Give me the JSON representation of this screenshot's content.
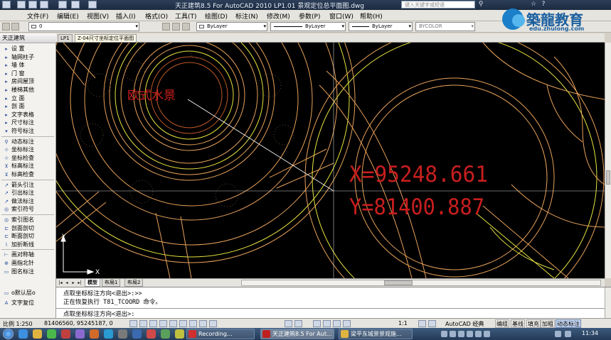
{
  "window": {
    "title": "天正建筑8.5 For AutoCAD 2010    LP1.01 景观定位总平面图.dwg",
    "search_placeholder": "键入关键字或短语"
  },
  "menu": {
    "items": [
      "文件(F)",
      "编辑(E)",
      "视图(V)",
      "插入(I)",
      "格式(O)",
      "工具(T)",
      "绘图(D)",
      "标注(N)",
      "修改(M)",
      "参数(P)",
      "窗口(W)",
      "帮助(H)"
    ]
  },
  "logo": {
    "text": "築龍教育",
    "url": "edu.zhulong.com"
  },
  "toolbar": {
    "layer": "0",
    "color": "ByLayer",
    "linetype": "ByLayer",
    "lineweight": "ByLayer",
    "plotstyle": "BYCOLOR"
  },
  "sidebar": {
    "title": "天正建筑",
    "items": [
      {
        "label": "设    置",
        "glyph": "▸"
      },
      {
        "label": "轴网柱子",
        "glyph": "▸"
      },
      {
        "label": "墙    体",
        "glyph": "▸"
      },
      {
        "label": "门    窗",
        "glyph": "▸"
      },
      {
        "label": "房间屋顶",
        "glyph": "▸"
      },
      {
        "label": "楼梯其他",
        "glyph": "▸"
      },
      {
        "label": "立    面",
        "glyph": "▸"
      },
      {
        "label": "剖    面",
        "glyph": "▸"
      },
      {
        "label": "文字表格",
        "glyph": "▸"
      },
      {
        "label": "尺寸标注",
        "glyph": "▸"
      },
      {
        "label": "符号标注",
        "glyph": "▾"
      },
      {
        "label": "动态标注",
        "glyph": "⚲"
      },
      {
        "label": "坐标标注",
        "glyph": "⊹"
      },
      {
        "label": "坐标检查",
        "glyph": "⊹"
      },
      {
        "label": "标高标注",
        "glyph": "⊻"
      },
      {
        "label": "标高检查",
        "glyph": "⊻"
      },
      {
        "label": "箭头引注",
        "glyph": "↗"
      },
      {
        "label": "引出标注",
        "glyph": "↗"
      },
      {
        "label": "做法标注",
        "glyph": "↗"
      },
      {
        "label": "索引符号",
        "glyph": "◎"
      },
      {
        "label": "索引图名",
        "glyph": "◎"
      },
      {
        "label": "剖面剖切",
        "glyph": "⊏"
      },
      {
        "label": "断面剖切",
        "glyph": "⊏"
      },
      {
        "label": "加折断线",
        "glyph": "⌇"
      },
      {
        "label": "画对称轴",
        "glyph": "⊢"
      },
      {
        "label": "画指北针",
        "glyph": "⊕"
      },
      {
        "label": "图名标注",
        "glyph": "▭"
      }
    ],
    "bottom_items": [
      "o默认层o",
      "文字复位"
    ]
  },
  "doc_tabs": [
    "LP1",
    "Z-04尺寸坐标定位平面图"
  ],
  "canvas": {
    "text_label": "欧式水景",
    "coord_x": "X=95248.661",
    "coord_y": "Y=81400.887",
    "axis_x": "X",
    "axis_y": "Y"
  },
  "layout_tabs": [
    "模型",
    "布局1",
    "布局2"
  ],
  "command_lines": [
    "点取坐标标注方向<退出>:>>",
    "正在恢复执行 T81_TCOORD 命令。",
    "点取坐标标注方向<退出>:"
  ],
  "status": {
    "scale": "比例 1:250",
    "coords": "81406560, 95245187, 0",
    "annotation_scale": "1:1",
    "workspace": "AutoCAD 经典",
    "toggles": [
      "编组",
      "基线",
      "填充",
      "加粗",
      "动态标注"
    ]
  },
  "taskbar": {
    "buttons": [
      "Recording...",
      "天正建筑8.5 For Aut...",
      "梁平东城景景观施..."
    ],
    "clock": "11:34"
  },
  "colors": {
    "canvas_bg": "#000000",
    "ring_orange": "#e8a25a",
    "ring_yellow": "#e6e640",
    "coord_red": "#c81e1e",
    "crosshair": "#ffffff"
  }
}
